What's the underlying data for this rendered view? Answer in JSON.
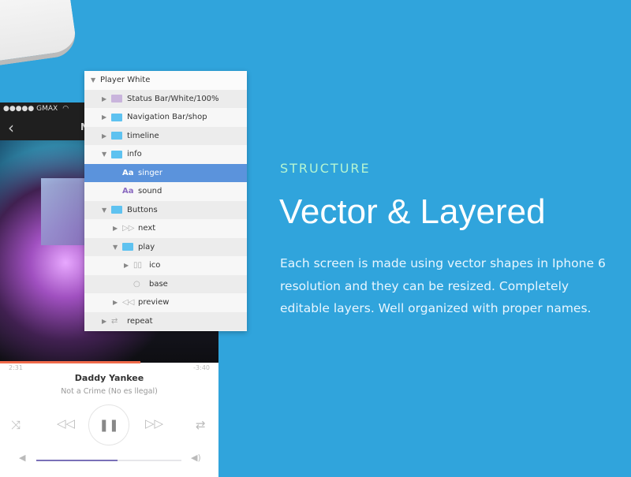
{
  "phone": {
    "carrier": "●●●●● GMAX",
    "nav_title": "N",
    "time_elapsed": "2:31",
    "time_remaining": "-3:40",
    "singer": "Daddy Yankee",
    "song": "Not a Crime (No es llegal)",
    "progress_percent": 42,
    "volume_percent": 56
  },
  "layers": {
    "root": "Player White",
    "items": [
      {
        "label": "Status Bar/White/100%",
        "icon": "folder-purple",
        "level": 1,
        "state": "collapsed"
      },
      {
        "label": "Navigation Bar/shop",
        "icon": "folder",
        "level": 1,
        "state": "collapsed"
      },
      {
        "label": "timeline",
        "icon": "folder",
        "level": 1,
        "state": "collapsed"
      },
      {
        "label": "info",
        "icon": "folder",
        "level": 1,
        "state": "expanded"
      },
      {
        "label": "singer",
        "icon": "text",
        "level": 2,
        "selected": true
      },
      {
        "label": "sound",
        "icon": "text",
        "level": 2
      },
      {
        "label": "Buttons",
        "icon": "folder",
        "level": 1,
        "state": "expanded"
      },
      {
        "label": "next",
        "icon": "next-symbol",
        "level": 2,
        "state": "collapsed"
      },
      {
        "label": "play",
        "icon": "folder",
        "level": 2,
        "state": "expanded"
      },
      {
        "label": "ico",
        "icon": "pause-symbol",
        "level": 3,
        "state": "collapsed"
      },
      {
        "label": "base",
        "icon": "circle",
        "level": 3
      },
      {
        "label": "preview",
        "icon": "previous-symbol",
        "level": 2,
        "state": "collapsed"
      },
      {
        "label": "repeat",
        "icon": "repeat-symbol",
        "level": 1,
        "state": "collapsed"
      }
    ]
  },
  "text_icon": "Aa",
  "content": {
    "eyebrow": "STRUCTURE",
    "title": "Vector & Layered",
    "body": "Each screen is made using vector shapes in Iphone 6 resolution and they can be resized. Completely editable layers. Well organized with proper names."
  },
  "colors": {
    "background": "#30a4dc",
    "selected": "#5b93dc",
    "eyebrow": "#b4f5d2",
    "progress": "#f06a4a"
  }
}
